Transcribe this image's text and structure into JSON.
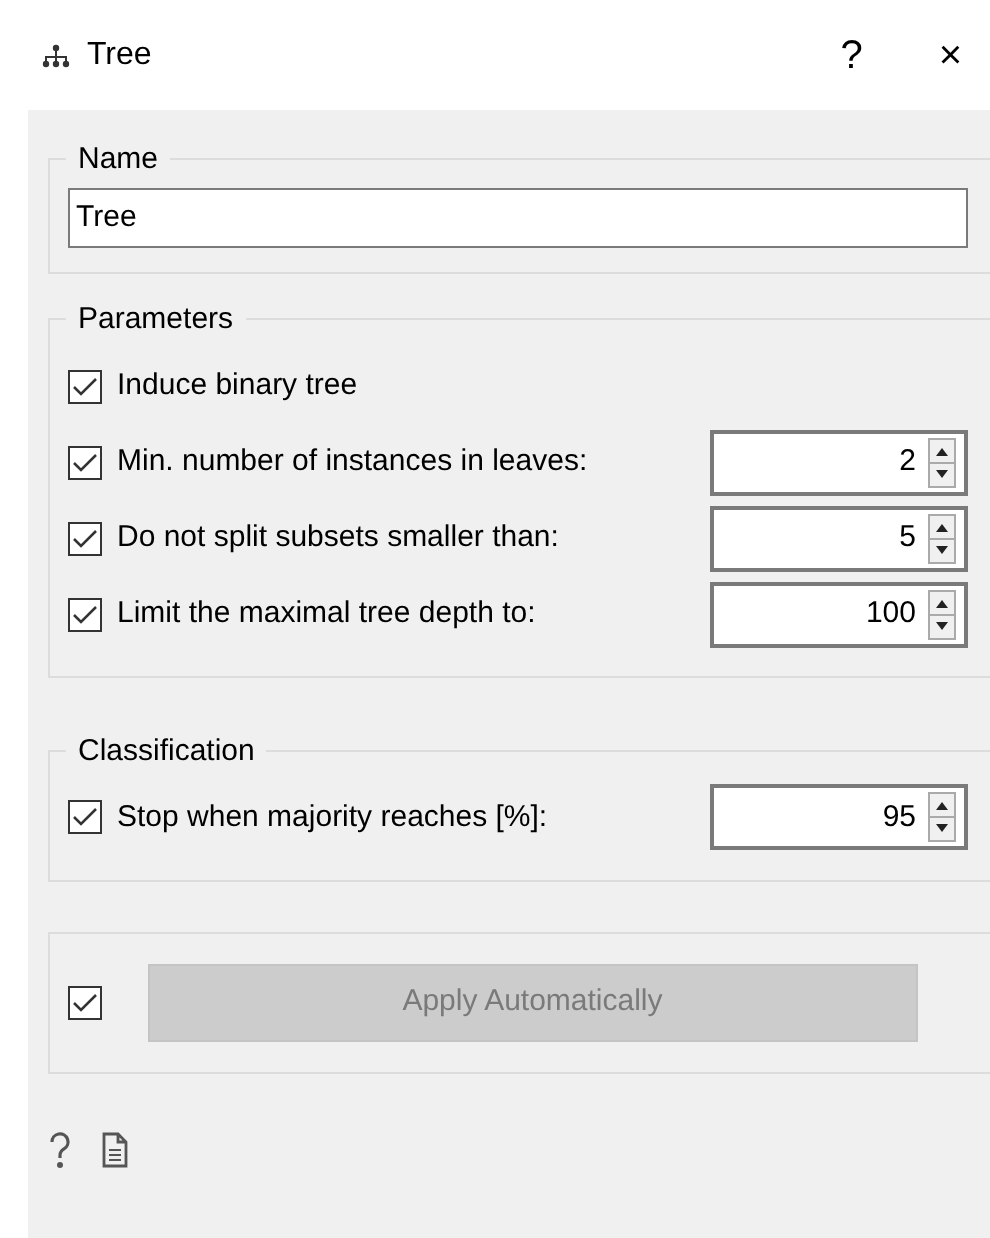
{
  "window": {
    "title": "Tree",
    "help_glyph": "?",
    "close_glyph": "×"
  },
  "name_group": {
    "title": "Name",
    "value": "Tree"
  },
  "parameters": {
    "title": "Parameters",
    "options": [
      {
        "label": "Induce binary tree",
        "checked": true
      },
      {
        "label": "Min. number of instances in leaves:",
        "checked": true,
        "value": "2"
      },
      {
        "label": "Do not split subsets smaller than:",
        "checked": true,
        "value": "5"
      },
      {
        "label": "Limit the maximal tree depth to:",
        "checked": true,
        "value": "100"
      }
    ]
  },
  "classification": {
    "title": "Classification",
    "options": [
      {
        "label": "Stop when majority reaches [%]:",
        "checked": true,
        "value": "95"
      }
    ]
  },
  "apply": {
    "checked": true,
    "label": "Apply Automatically",
    "disabled": true
  }
}
